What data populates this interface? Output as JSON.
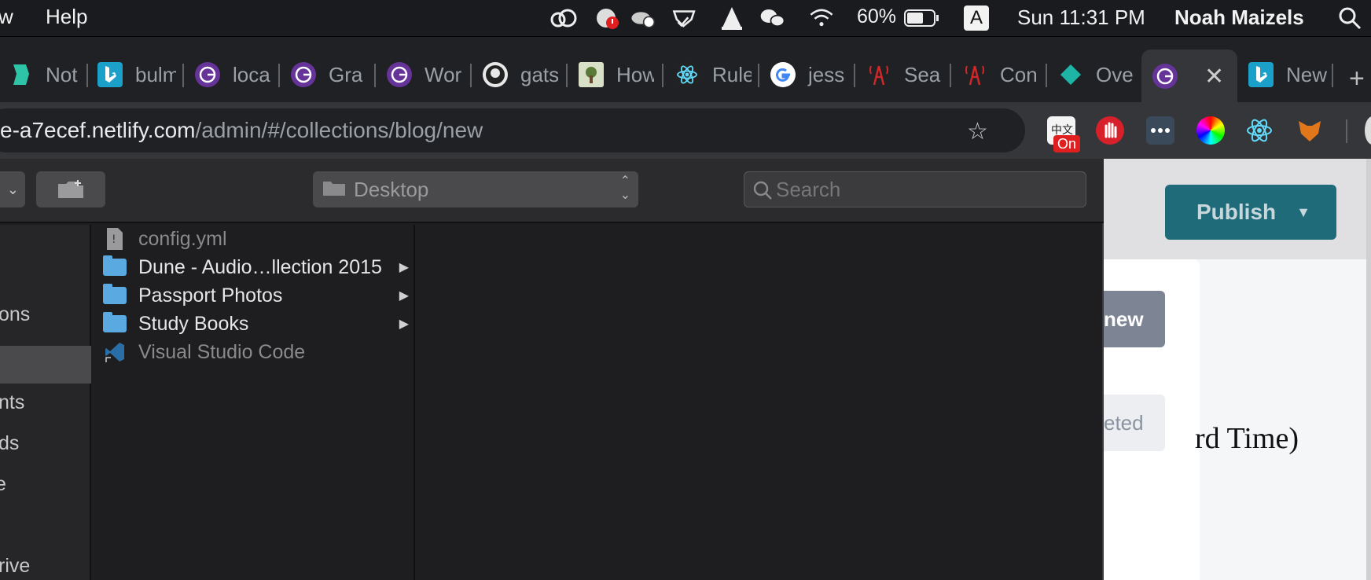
{
  "menubar": {
    "menu_partial": "w",
    "help": "Help",
    "battery": "60%",
    "input_source": "A",
    "clock": "Sun 11:31 PM",
    "user": "Noah Maizels"
  },
  "tabs": [
    {
      "label": "Noti",
      "icon": "notion-like-icon"
    },
    {
      "label": "bulm",
      "icon": "bing-icon"
    },
    {
      "label": "loca",
      "icon": "gatsby-icon"
    },
    {
      "label": "Gra",
      "icon": "gatsby-icon"
    },
    {
      "label": "Wor",
      "icon": "gatsby-icon"
    },
    {
      "label": "gats",
      "icon": "github-icon"
    },
    {
      "label": "How",
      "icon": "tree-icon"
    },
    {
      "label": "Rule",
      "icon": "react-icon"
    },
    {
      "label": "jess",
      "icon": "google-icon"
    },
    {
      "label": "Sea",
      "icon": "tower-icon"
    },
    {
      "label": "Con",
      "icon": "tower-icon"
    },
    {
      "label": "Ove",
      "icon": "diamond-icon"
    },
    {
      "label": "",
      "icon": "gatsby-icon",
      "active": true
    },
    {
      "label": "New",
      "icon": "bing-icon"
    }
  ],
  "address": {
    "host": "e-a7ecef.netlify.com",
    "path": "/admin/#/collections/blog/new"
  },
  "extension_badge": "On",
  "dialog": {
    "location": "Desktop",
    "search_placeholder": "Search",
    "sidebar": [
      "ons",
      "nts",
      "ds",
      "e",
      "rive"
    ],
    "files": [
      {
        "name": "config.yml",
        "kind": "file",
        "dim": true
      },
      {
        "name": "Dune - Audio…llection 2015",
        "kind": "folder",
        "dim": false
      },
      {
        "name": "Passport Photos",
        "kind": "folder",
        "dim": false
      },
      {
        "name": "Study Books",
        "kind": "folder",
        "dim": false
      },
      {
        "name": "Visual Studio Code",
        "kind": "app",
        "dim": true
      }
    ]
  },
  "page": {
    "publish": "Publish",
    "new_button": "new",
    "deleted_button": "eted",
    "time_text": "rd Time)"
  },
  "colors": {
    "publish_bg": "#1f6b7a",
    "folder": "#5aa9e0"
  }
}
